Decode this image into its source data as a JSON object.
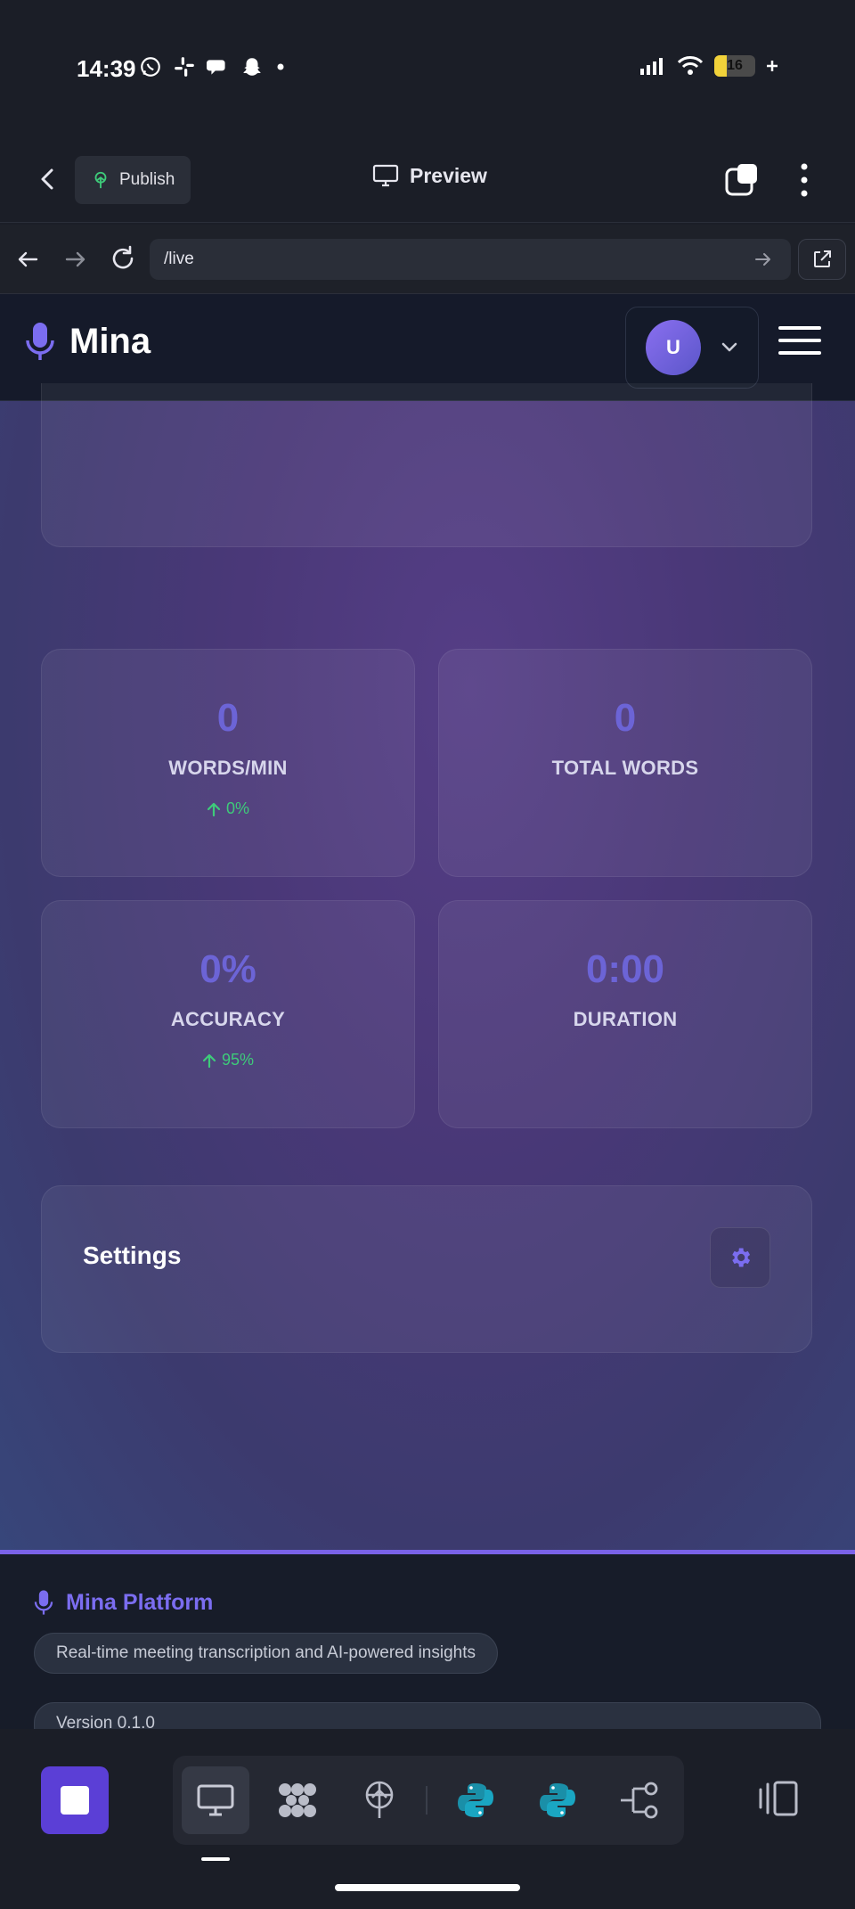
{
  "status_bar": {
    "time": "14:39",
    "battery": "16",
    "icons": [
      "whatsapp-icon",
      "slack-icon",
      "chat-icon",
      "snapchat-icon",
      "dot-icon",
      "signal-icon",
      "wifi-icon",
      "battery-icon"
    ]
  },
  "app_bar": {
    "publish_label": "Publish",
    "preview_label": "Preview"
  },
  "browser": {
    "url": "/live"
  },
  "site_header": {
    "brand": "Mina",
    "avatar_initial": "U"
  },
  "stats": [
    {
      "value": "0",
      "label": "WORDS/MIN",
      "trend": "0%"
    },
    {
      "value": "0",
      "label": "TOTAL WORDS",
      "trend": ""
    },
    {
      "value": "0%",
      "label": "ACCURACY",
      "trend": "95%"
    },
    {
      "value": "0:00",
      "label": "DURATION",
      "trend": ""
    }
  ],
  "settings": {
    "title": "Settings"
  },
  "footer": {
    "brand": "Mina Platform",
    "tagline": "Real-time meeting transcription and AI-powered insights",
    "version": "Version 0.1.0"
  },
  "colors": {
    "accent": "#6c64d6",
    "footer_accent": "#7b6df0",
    "trend_up": "#3ecb7a",
    "stop_button": "#5b3fd6"
  }
}
